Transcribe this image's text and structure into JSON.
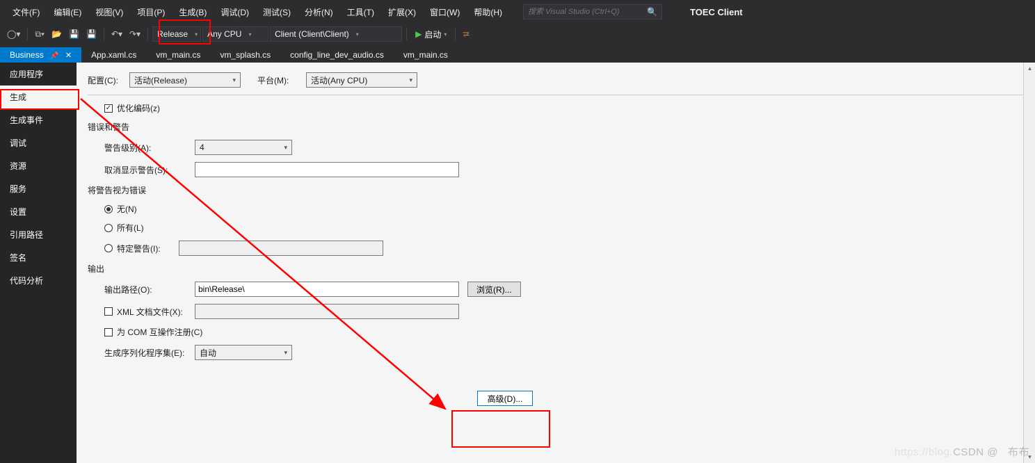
{
  "menubar": {
    "items": [
      "文件(F)",
      "编辑(E)",
      "视图(V)",
      "项目(P)",
      "生成(B)",
      "调试(D)",
      "测试(S)",
      "分析(N)",
      "工具(T)",
      "扩展(X)",
      "窗口(W)",
      "帮助(H)"
    ],
    "search_placeholder": "搜索 Visual Studio (Ctrl+Q)",
    "app_name": "TOEC Client"
  },
  "toolbar": {
    "config": "Release",
    "platform": "Any CPU",
    "project": "Client (Client\\Client)",
    "start_label": "启动"
  },
  "doc_tabs": [
    "Business",
    "App.xaml.cs",
    "vm_main.cs",
    "vm_splash.cs",
    "config_line_dev_audio.cs",
    "vm_main.cs"
  ],
  "sidebar": {
    "items": [
      "应用程序",
      "生成",
      "生成事件",
      "调试",
      "资源",
      "服务",
      "设置",
      "引用路径",
      "签名",
      "代码分析"
    ],
    "active_index": 1
  },
  "props": {
    "config_label": "配置(C):",
    "config_value": "活动(Release)",
    "platform_label": "平台(M):",
    "platform_value": "活动(Any CPU)",
    "optimize_label": "优化编码(z)",
    "errors_section": "错误和警告",
    "warn_level_label": "警告级别(A):",
    "warn_level_value": "4",
    "suppress_label": "取消显示警告(S):",
    "suppress_value": "",
    "treat_as_error_section": "将警告视为错误",
    "radio_none": "无(N)",
    "radio_all": "所有(L)",
    "radio_specific": "特定警告(I):",
    "specific_value": "",
    "output_section": "输出",
    "output_path_label": "输出路径(O):",
    "output_path_value": "bin\\Release\\",
    "browse_label": "浏览(R)...",
    "xml_doc_label": "XML 文档文件(X):",
    "xml_doc_value": "",
    "com_interop_label": "为 COM 互操作注册(C)",
    "serialize_label": "生成序列化程序集(E):",
    "serialize_value": "自动",
    "advanced_label": "高级(D)..."
  },
  "watermark": {
    "full": "https://blog.CSDN @   布布"
  }
}
